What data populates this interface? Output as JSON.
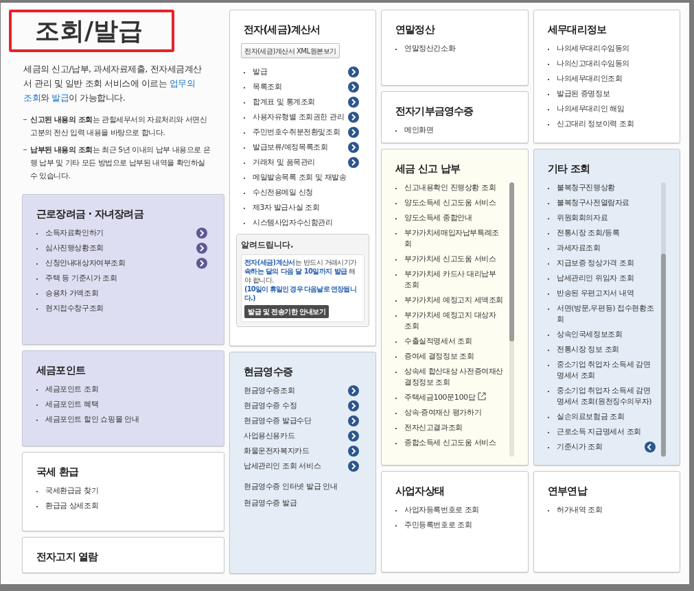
{
  "page_title": "조회/발급",
  "intro": [
    {
      "text": "세금의 신고/납부, 과세자료제출, 전자세금계산서 관리 및 일반 조회 서비스에 이르는 ",
      "highlight": false
    },
    {
      "text": "업무의 조회",
      "highlight": true
    },
    {
      "text": "와 ",
      "highlight": false
    },
    {
      "text": "발급",
      "highlight": true
    },
    {
      "text": "이 가능합니다.",
      "highlight": false
    }
  ],
  "notes": [
    "**신고된 내용의 조회**는 관할세무서의 자료처리와 서면신고분의 전산 입력 내용을 바탕으로 합니다.",
    "**납부된 내용의 조회**는 최근 5년 이내의 납부 내용으로 은행 납부 및 기타 모든 방법으로 납부된 내역을 확인하실 수 있습니다."
  ],
  "columns": [
    {
      "cards": [
        {
          "title": "근로장려금 · 자녀장려금",
          "color": "#dedef3",
          "bullets": true,
          "items": [
            {
              "label": "소득자료확인하기",
              "kind": "arrow"
            },
            {
              "label": "심사진행상황조회",
              "kind": "arrow"
            },
            {
              "label": "신청안내대상자여부조회",
              "kind": "arrow"
            },
            {
              "label": "주택 등 기준시가 조회",
              "kind": "plain"
            },
            {
              "label": "승용차 가액조회",
              "kind": "plain"
            },
            {
              "label": "현지접수창구조회",
              "kind": "plain"
            }
          ]
        },
        {
          "title": "세금포인트",
          "color": "#dedef3",
          "bullets": true,
          "items": [
            {
              "label": "세금포인트 조회",
              "kind": "plain"
            },
            {
              "label": "세금포인트 혜택",
              "kind": "plain"
            },
            {
              "label": "세금포인트 할인 쇼핑몰 안내",
              "kind": "plain"
            }
          ]
        },
        {
          "title": "국세 환급",
          "color": "#ffffff",
          "bullets": true,
          "items": [
            {
              "label": "국세환급금 찾기",
              "kind": "plain"
            },
            {
              "label": "환급금 상세조회",
              "kind": "plain"
            }
          ]
        },
        {
          "title": "전자고지 열람",
          "color": "#ffffff"
        }
      ]
    },
    {
      "cards": [
        {
          "title": "전자(세금)계산서",
          "color": "#ffffff",
          "bullets": true,
          "button": "전자(세금)계산서 XML원본보기",
          "items": [
            {
              "label": "발급",
              "kind": "arrow"
            },
            {
              "label": "목록조회",
              "kind": "arrow"
            },
            {
              "label": "합계표 및 통계조회",
              "kind": "arrow"
            },
            {
              "label": "사용자유형별 조회권한 관리",
              "kind": "arrow"
            },
            {
              "label": "주민번호수취분전환및조회",
              "kind": "arrow"
            },
            {
              "label": "발급보류/예정목록조회",
              "kind": "arrow"
            },
            {
              "label": "거래처 및 품목관리",
              "kind": "arrow"
            },
            {
              "label": "메일발송목록 조회 및 재발송",
              "kind": "plain"
            },
            {
              "label": "수신전용메일 신청",
              "kind": "plain"
            },
            {
              "label": "제3자 발급사실 조회",
              "kind": "plain"
            },
            {
              "label": "시스템사업자수신함관리",
              "kind": "plain"
            }
          ],
          "notice": {
            "title": "알려드립니다.",
            "text": [
              {
                "text": "전자(세금)계산서",
                "highlight": true
              },
              {
                "text": "는 반드시 거래시기가 ",
                "highlight": false
              },
              {
                "text": "속하는 달의 다음 달 10일까지 발급",
                "highlight": true
              },
              {
                "text": " 해야 합니다.",
                "highlight": false
              }
            ],
            "note": "(10일이 휴일인 경우 다음날로 연장됩니다.)",
            "button": "발급 및 전송기한 안내보기"
          }
        },
        {
          "title": "현금영수증",
          "color": "#e4ecf5",
          "bullets": false,
          "items": [
            {
              "label": "현금영수증조회",
              "kind": "arrow"
            },
            {
              "label": "현금영수증 수정",
              "kind": "arrow"
            },
            {
              "label": "현금영수증 발급수단",
              "kind": "arrow"
            },
            {
              "label": "사업용신용카드",
              "kind": "arrow"
            },
            {
              "label": "화물운전자복지카드",
              "kind": "arrow"
            },
            {
              "label": "납세관리인 조회 서비스",
              "kind": "arrow"
            }
          ],
          "extra_links": [
            "현금영수증 인터넷 발급 안내",
            "현금영수증 발급"
          ]
        }
      ]
    },
    {
      "cards": [
        {
          "title": "연말정산",
          "color": "#ffffff",
          "bullets": true,
          "items": [
            {
              "label": "연말정산간소화",
              "kind": "plain"
            }
          ]
        },
        {
          "title": "전자기부금영수증",
          "color": "#ffffff",
          "bullets": true,
          "items": [
            {
              "label": "메인화면",
              "kind": "plain"
            }
          ]
        },
        {
          "title": "세금 신고 납부",
          "color": "#fefdf1",
          "bullets": true,
          "scrollable": true,
          "items": [
            {
              "label": "신고내용확인 진행상황 조회",
              "kind": "plain"
            },
            {
              "label": "양도소득세 신고도움 서비스",
              "kind": "plain"
            },
            {
              "label": "양도소득세 종합안내",
              "kind": "plain"
            },
            {
              "label": "부가가치세매입자납부특례조회",
              "kind": "plain"
            },
            {
              "label": "부가가치세 신고도움 서비스",
              "kind": "plain"
            },
            {
              "label": "부가가치세 카드사 대리납부 조회",
              "kind": "plain"
            },
            {
              "label": "부가가치세 예정고지 세액조회",
              "kind": "plain"
            },
            {
              "label": "부가가치세 예정고지 대상자 조회",
              "kind": "plain"
            },
            {
              "label": "수출실적명세서 조회",
              "kind": "plain"
            },
            {
              "label": "증여세 결정정보 조회",
              "kind": "plain"
            },
            {
              "label": "상속세 합산대상 사전증여재산 결정정보 조회",
              "kind": "plain"
            },
            {
              "label": "주택세금100문100답",
              "kind": "external"
            },
            {
              "label": "상속·증여재산 평가하기",
              "kind": "plain"
            },
            {
              "label": "전자신고결과조회",
              "kind": "plain"
            },
            {
              "label": "종합소득세 신고도움 서비스",
              "kind": "plain"
            }
          ]
        },
        {
          "title": "사업자상태",
          "color": "#ffffff",
          "bullets": true,
          "items": [
            {
              "label": "사업자등록번호로 조회",
              "kind": "plain"
            },
            {
              "label": "주민등록번호로 조회",
              "kind": "plain"
            }
          ]
        }
      ]
    },
    {
      "cards": [
        {
          "title": "세무대리정보",
          "color": "#ffffff",
          "bullets": true,
          "items": [
            {
              "label": "나의세무대리수임동의",
              "kind": "plain"
            },
            {
              "label": "나의신고대리수임동의",
              "kind": "plain"
            },
            {
              "label": "나의세무대리인조회",
              "kind": "plain"
            },
            {
              "label": "발급된 증명정보",
              "kind": "plain"
            },
            {
              "label": "나의세무대리인 해임",
              "kind": "plain"
            },
            {
              "label": "신고대리 정보이력 조회",
              "kind": "plain"
            }
          ]
        },
        {
          "title": "기타 조회",
          "color": "#e4ecf5",
          "bullets": true,
          "scrollable": true,
          "items": [
            {
              "label": "불복청구진행상황",
              "kind": "plain"
            },
            {
              "label": "불복청구사전열람자료",
              "kind": "plain"
            },
            {
              "label": "위원회회의자료",
              "kind": "plain"
            },
            {
              "label": "전통시장 조회/등록",
              "kind": "plain"
            },
            {
              "label": "과세자료조회",
              "kind": "plain"
            },
            {
              "label": "지급보증 정상가격 조회",
              "kind": "plain"
            },
            {
              "label": "납세관리인 위임자 조회",
              "kind": "plain"
            },
            {
              "label": "반송된 우편고지서 내역",
              "kind": "plain"
            },
            {
              "label": "서면(방문,우편등) 접수현황조회",
              "kind": "plain"
            },
            {
              "label": "상속인국세정보조회",
              "kind": "plain"
            },
            {
              "label": "전통시장 정보 조회",
              "kind": "plain"
            },
            {
              "label": "중소기업 취업자 소득세 감면 명세서 조회",
              "kind": "plain"
            },
            {
              "label": "중소기업 취업자 소득세 감면 명세서 조회(원천징수의무자)",
              "kind": "plain"
            },
            {
              "label": "실손의료보험금 조회",
              "kind": "plain"
            },
            {
              "label": "근로소득 지급명세서 조회",
              "kind": "plain"
            },
            {
              "label": "기준시가 조회",
              "kind": "back"
            }
          ]
        },
        {
          "title": "연부연납",
          "color": "#ffffff",
          "bullets": true,
          "items": [
            {
              "label": "허가내역 조회",
              "kind": "plain"
            }
          ]
        }
      ]
    }
  ]
}
